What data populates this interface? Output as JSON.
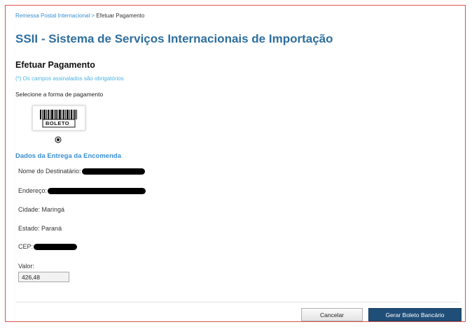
{
  "breadcrumb": {
    "parent": "Remessa Postal Internacional >",
    "current": "Efetuar Pagamento"
  },
  "page_title": "SSII - Sistema de Serviços Internacionais de Importação",
  "section_title": "Efetuar Pagamento",
  "required_note": "(*) Os campos assinalados são obrigatórios",
  "payment": {
    "label": "Selecione a forma de pagamento",
    "option_label": "BOLETO",
    "selected": true
  },
  "delivery": {
    "title": "Dados da Entrega da Encomenda",
    "recipient_label": "Nome do Destinatário:",
    "address_label": "Endereço:",
    "city_label": "Cidade:",
    "city_value": "Maringá",
    "state_label": "Estado:",
    "state_value": "Paraná",
    "cep_label": "CEP:"
  },
  "valor": {
    "label": "Valor:",
    "value": "426,48"
  },
  "buttons": {
    "cancel": "Cancelar",
    "submit": "Gerar Boleto Bancário"
  },
  "colors": {
    "title_blue": "#2e6e9e",
    "link_blue": "#3a8fd0",
    "primary_button": "#1f4e79",
    "frame_border": "#d9534f"
  }
}
